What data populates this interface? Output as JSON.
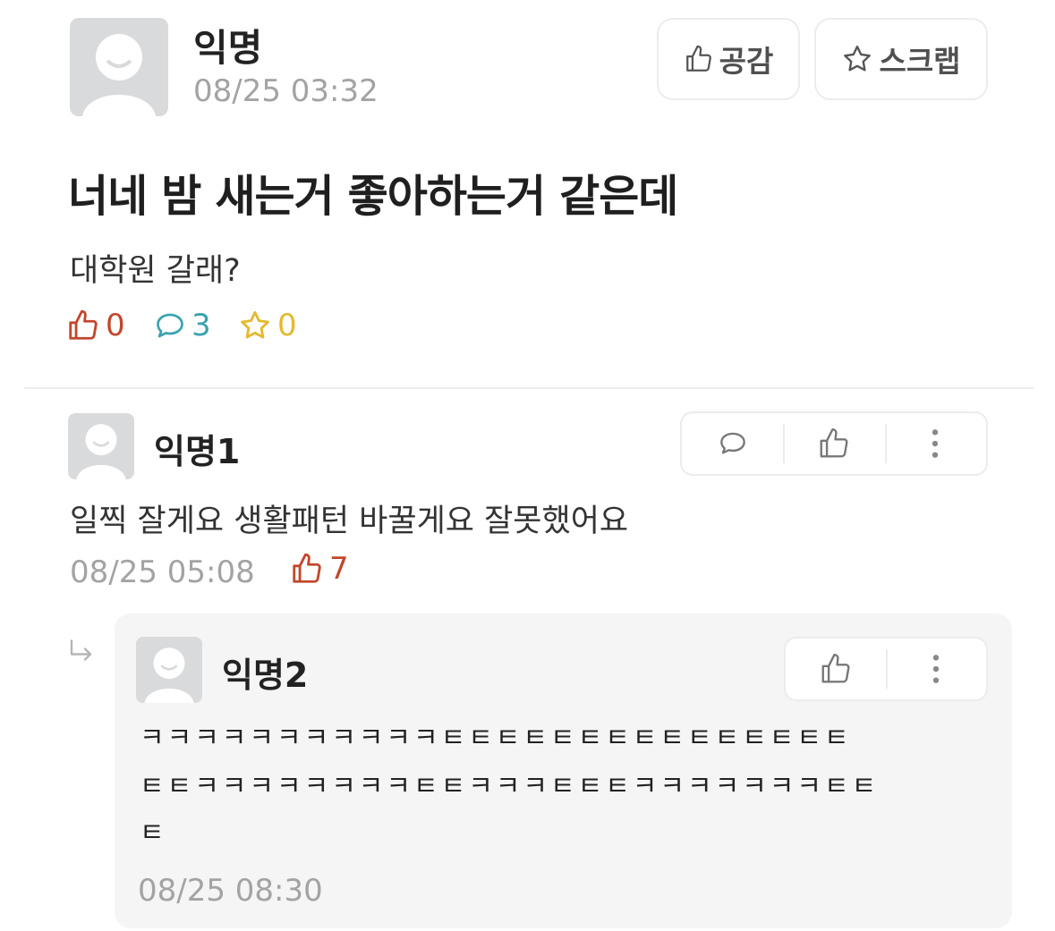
{
  "post": {
    "author": "익명",
    "timestamp": "08/25 03:32",
    "like_button_label": "공감",
    "scrap_button_label": "스크랩",
    "title": "너네 밤 새는거 좋아하는거 같은데",
    "body": "대학원 갈래?",
    "stats": {
      "likes": "0",
      "comments": "3",
      "scraps": "0"
    }
  },
  "comments": [
    {
      "author": "익명1",
      "text": "일찍 잘게요 생활패턴 바꿀게요 잘못했어요",
      "timestamp": "08/25 05:08",
      "likes": "7"
    }
  ],
  "reply": {
    "author": "익명2",
    "lines": [
      "ㅋㅋㅋㅋㅋㅋㅋㅋㅋㅋㅋㅌㅌㅌㅌㅌㅌㅌㅌㅌㅌㅌㅌㅌㅌㅌ",
      "ㅌㅌㅋㅋㅋㅋㅋㅋㅋㅋㅌㅌㅋㅋㅋㅌㅌㅌㅋㅋㅋㅋㅋㅋㅋㅌㅌ",
      "ㅌ"
    ],
    "timestamp": "08/25 08:30"
  },
  "colors": {
    "like_red": "#c2472c",
    "comment_teal": "#3aa3b0",
    "scrap_yellow": "#e5b92e",
    "meta_gray": "#a3a3a3"
  },
  "icons": [
    "avatar-icon",
    "thumbs-up-icon",
    "star-icon",
    "comment-bubble-icon",
    "more-vertical-icon",
    "reply-arrow-icon"
  ]
}
